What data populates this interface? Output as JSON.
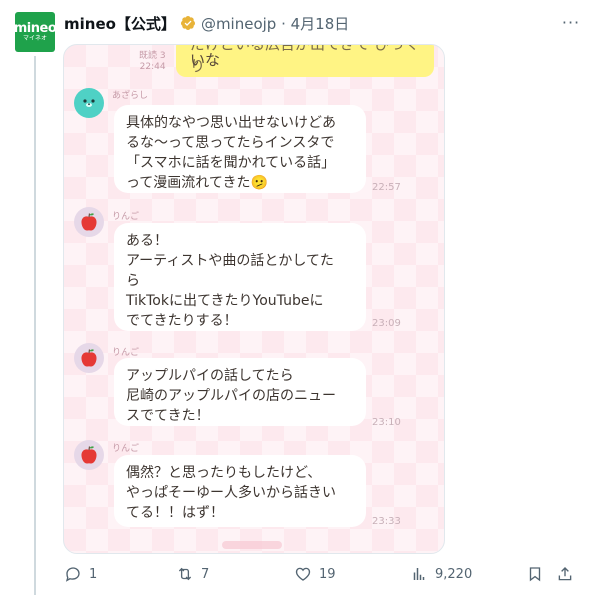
{
  "tweet": {
    "author_name": "mineo【公式】",
    "handle_date": "@mineojp · 4月18日",
    "avatar_logo": "mineo",
    "avatar_sub": "マイネオ",
    "more_label": "···"
  },
  "chat": {
    "top_partial_line1": "だけどいる広告が出てきて びっくり",
    "top_partial_line2": "いな",
    "top_read_label": "既読 3",
    "top_time": "22:44",
    "messages": [
      {
        "sender": "あざらし",
        "lines": [
          "具体的なやつ思い出せないけどあ",
          "るな〜って思ってたらインスタで",
          "「スマホに話を聞かれている話」",
          "って漫画流れてきた🫤"
        ],
        "time": "22:57"
      },
      {
        "sender": "りんご",
        "lines": [
          "ある！",
          "アーティストや曲の話とかしてた",
          "ら",
          "TikTokに出てきたりYouTubeに",
          "でてきたりする！"
        ],
        "time": "23:09"
      },
      {
        "sender": "りんご",
        "lines": [
          "アップルパイの話してたら",
          "尼崎のアップルパイの店のニュー",
          "スでてきた！"
        ],
        "time": "23:10"
      },
      {
        "sender": "りんご",
        "lines": [
          "偶然？と思ったりもしたけど、",
          "やっぱそーゆー人多いから話きい",
          "てる！！はず！"
        ],
        "time": "23:33"
      }
    ]
  },
  "actions": {
    "replies": "1",
    "reposts": "7",
    "likes": "19",
    "views": "9,220"
  },
  "colors": {
    "brand_green": "#1fa24b",
    "chat_background": "#fde9ee",
    "own_bubble": "#fff484",
    "verified_gold": "#e8b339"
  }
}
